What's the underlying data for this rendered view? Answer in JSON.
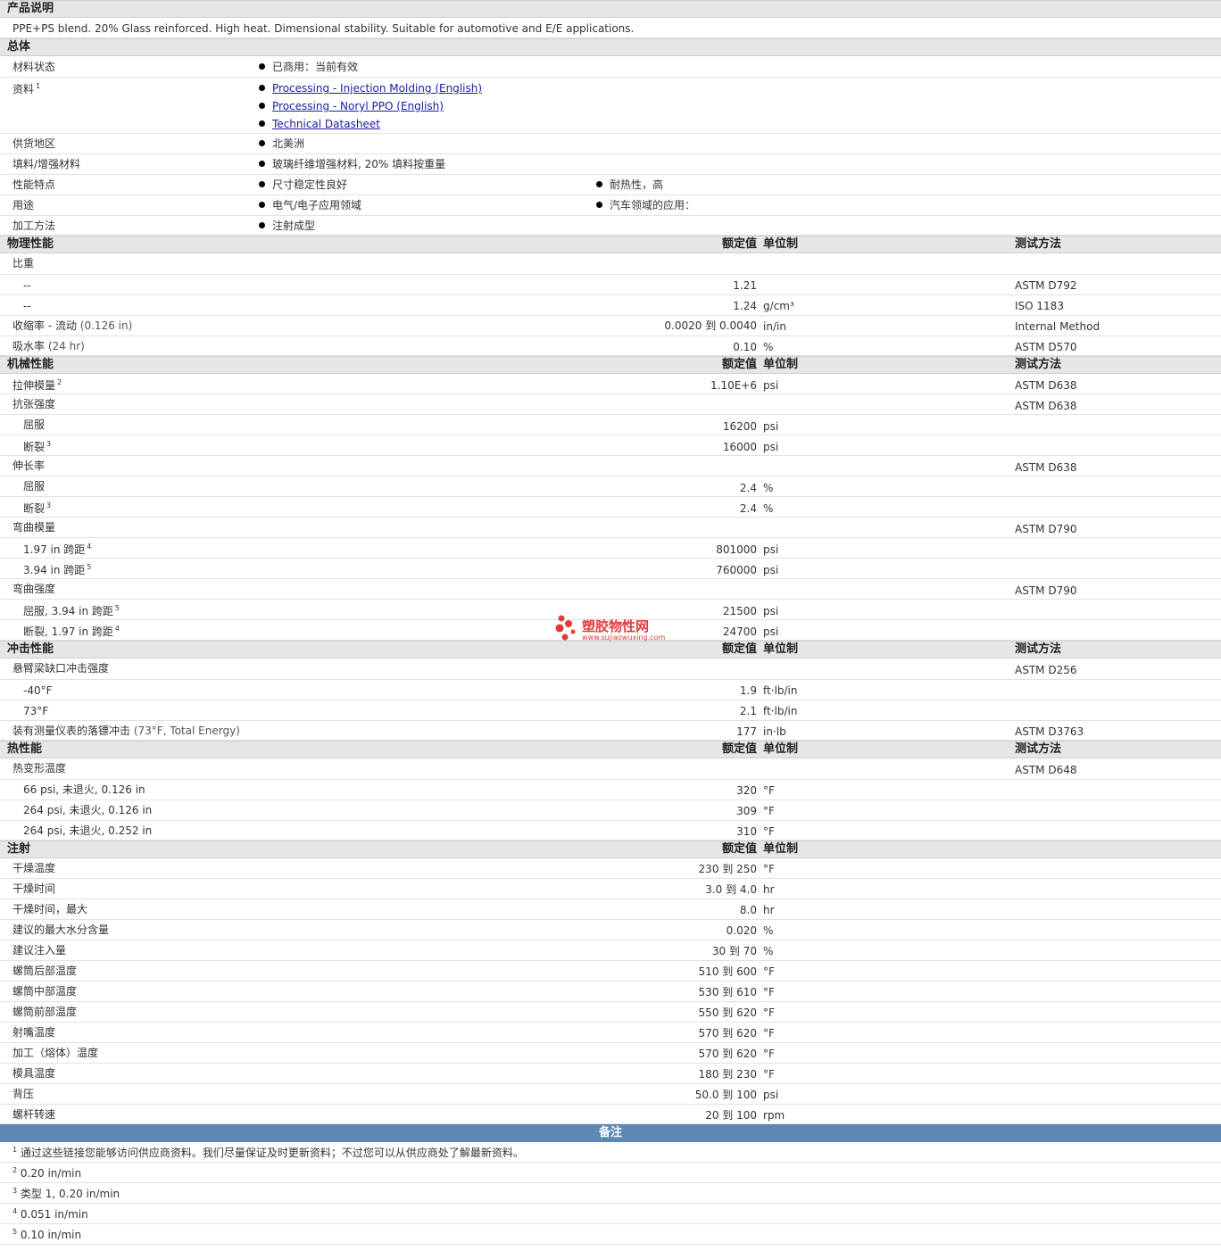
{
  "sections": {
    "product_desc": {
      "title": "产品说明",
      "text": "PPE+PS blend. 20% Glass reinforced. High heat. Dimensional stability. Suitable for automotive and E/E applications."
    },
    "general": {
      "title": "总体",
      "material_status": {
        "label": "材料状态",
        "value": "已商用：当前有效"
      },
      "literature": {
        "label": "资料",
        "sup": "1",
        "links": [
          "Processing - Injection Molding (English)",
          "Processing - Noryl PPO (English)",
          "Technical Datasheet"
        ]
      },
      "availability": {
        "label": "供货地区",
        "value": "北美洲"
      },
      "filler": {
        "label": "填料/增强材料",
        "value": "玻璃纤维增强材料, 20% 填料按重量"
      },
      "features": {
        "label": "性能特点",
        "values": [
          "尺寸稳定性良好",
          "耐热性，高"
        ]
      },
      "uses": {
        "label": "用途",
        "values": [
          "电气/电子应用领域",
          "汽车领域的应用："
        ]
      },
      "processing": {
        "label": "加工方法",
        "value": "注射成型"
      }
    },
    "col_headers": {
      "value": "额定值",
      "unit": "单位制",
      "test": "测试方法"
    },
    "physical": {
      "title": "物理性能",
      "specific_gravity": {
        "label": "比重"
      },
      "sg1": {
        "label": "--",
        "value": "1.21",
        "unit": "",
        "test": "ASTM D792"
      },
      "sg2": {
        "label": "--",
        "value": "1.24",
        "unit": "g/cm³",
        "test": "ISO 1183"
      },
      "shrink": {
        "label": "收缩率 - 流动",
        "cond": "(0.126 in)",
        "value": "0.0020 到  0.0040",
        "unit": "in/in",
        "test": "Internal Method"
      },
      "water": {
        "label": "吸水率",
        "cond": "(24 hr)",
        "value": "0.10",
        "unit": "%",
        "test": "ASTM D570"
      }
    },
    "mechanical": {
      "title": "机械性能",
      "tensile_modulus": {
        "label": "拉伸模量",
        "sup": "2",
        "value": "1.10E+6",
        "unit": "psi",
        "test": "ASTM D638"
      },
      "tensile_strength": {
        "label": "抗张强度",
        "test": "ASTM D638"
      },
      "ts_yield": {
        "label": "屈服",
        "value": "16200",
        "unit": "psi"
      },
      "ts_break": {
        "label": "断裂",
        "sup": "3",
        "value": "16000",
        "unit": "psi"
      },
      "elongation": {
        "label": "伸长率",
        "test": "ASTM D638"
      },
      "el_yield": {
        "label": "屈服",
        "value": "2.4",
        "unit": "%"
      },
      "el_break": {
        "label": "断裂",
        "sup": "3",
        "value": "2.4",
        "unit": "%"
      },
      "flex_modulus": {
        "label": "弯曲模量",
        "test": "ASTM D790"
      },
      "fm1": {
        "label": "1.97 in 跨距",
        "sup": "4",
        "value": "801000",
        "unit": "psi"
      },
      "fm2": {
        "label": "3.94 in 跨距",
        "sup": "5",
        "value": "760000",
        "unit": "psi"
      },
      "flex_strength": {
        "label": "弯曲强度",
        "test": "ASTM D790"
      },
      "fs1": {
        "label": "屈服, 3.94 in 跨距",
        "sup": "5",
        "value": "21500",
        "unit": "psi"
      },
      "fs2": {
        "label": "断裂, 1.97 in 跨距",
        "sup": "4",
        "value": "24700",
        "unit": "psi"
      }
    },
    "impact": {
      "title": "冲击性能",
      "izod": {
        "label": "悬臂梁缺口冲击强度",
        "test": "ASTM D256"
      },
      "izod1": {
        "label": "-40°F",
        "value": "1.9",
        "unit": "ft·lb/in"
      },
      "izod2": {
        "label": "73°F",
        "value": "2.1",
        "unit": "ft·lb/in"
      },
      "dart": {
        "label": "装有测量仪表的落镖冲击",
        "cond": "(73°F, Total Energy)",
        "value": "177",
        "unit": "in·lb",
        "test": "ASTM D3763"
      }
    },
    "thermal": {
      "title": "热性能",
      "dtul": {
        "label": "热变形温度",
        "test": "ASTM D648"
      },
      "d1": {
        "label": "66 psi, 未退火, 0.126 in",
        "value": "320",
        "unit": "°F"
      },
      "d2": {
        "label": "264 psi, 未退火, 0.126 in",
        "value": "309",
        "unit": "°F"
      },
      "d3": {
        "label": "264 psi, 未退火, 0.252 in",
        "value": "310",
        "unit": "°F"
      }
    },
    "injection": {
      "title": "注射",
      "rows": [
        {
          "label": "干燥温度",
          "value": "230 到  250",
          "unit": "°F"
        },
        {
          "label": "干燥时间",
          "value": "3.0 到  4.0",
          "unit": "hr"
        },
        {
          "label": "干燥时间，最大",
          "value": "8.0",
          "unit": "hr"
        },
        {
          "label": "建议的最大水分含量",
          "value": "0.020",
          "unit": "%"
        },
        {
          "label": "建议注入量",
          "value": "30 到  70",
          "unit": "%"
        },
        {
          "label": "螺筒后部温度",
          "value": "510 到  600",
          "unit": "°F"
        },
        {
          "label": "螺筒中部温度",
          "value": "530 到  610",
          "unit": "°F"
        },
        {
          "label": "螺筒前部温度",
          "value": "550 到  620",
          "unit": "°F"
        },
        {
          "label": "射嘴温度",
          "value": "570 到  620",
          "unit": "°F"
        },
        {
          "label": "加工（熔体）温度",
          "value": "570 到  620",
          "unit": "°F"
        },
        {
          "label": "模具温度",
          "value": "180 到  230",
          "unit": "°F"
        },
        {
          "label": "背压",
          "value": "50.0 到  100",
          "unit": "psi"
        },
        {
          "label": "螺杆转速",
          "value": "20 到  100",
          "unit": "rpm"
        }
      ]
    },
    "notes": {
      "title": "备注",
      "items": [
        {
          "num": "1",
          "text": "通过这些链接您能够访问供应商资料。我们尽量保证及时更新资料；不过您可以从供应商处了解最新资料。"
        },
        {
          "num": "2",
          "text": "0.20 in/min"
        },
        {
          "num": "3",
          "text": "类型  1, 0.20 in/min"
        },
        {
          "num": "4",
          "text": "0.051 in/min"
        },
        {
          "num": "5",
          "text": "0.10 in/min"
        }
      ]
    }
  },
  "watermark": {
    "text": "塑胶物性网",
    "url": "www.sujiaowuxing.com",
    "color": "#e23b3b"
  }
}
